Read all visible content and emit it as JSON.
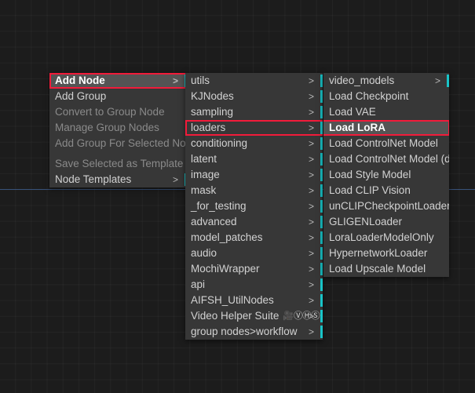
{
  "canvas": {
    "background_color": "#1c1c1c",
    "grid_color": "#2a2a2a",
    "guide_line_color": "#3d5a8a"
  },
  "theme": {
    "menu_background": "#373737",
    "text_color": "#d2d2d2",
    "disabled_text_color": "#8a8a8a",
    "hover_background": "#545454",
    "annotation_color": "#f21b3a",
    "submenu_tick_color": "#19c4c8"
  },
  "menus": {
    "root": {
      "items": [
        {
          "label": "Add Node",
          "submenu": true,
          "disabled": false,
          "highlighted": true,
          "annotated": true
        },
        {
          "label": "Add Group",
          "submenu": false,
          "disabled": false,
          "highlighted": false,
          "annotated": false
        },
        {
          "label": "Convert to Group Node",
          "submenu": false,
          "disabled": true,
          "highlighted": false,
          "annotated": false
        },
        {
          "label": "Manage Group Nodes",
          "submenu": false,
          "disabled": true,
          "highlighted": false,
          "annotated": false
        },
        {
          "label": "Add Group For Selected Nodes",
          "submenu": false,
          "disabled": true,
          "highlighted": false,
          "annotated": false
        },
        {
          "label": "Save Selected as Template",
          "submenu": false,
          "disabled": true,
          "highlighted": false,
          "annotated": false,
          "separator_above": true
        },
        {
          "label": "Node Templates",
          "submenu": true,
          "disabled": false,
          "highlighted": false,
          "annotated": false
        }
      ]
    },
    "categories": {
      "items": [
        {
          "label": "utils",
          "submenu": true,
          "annotated": false
        },
        {
          "label": "KJNodes",
          "submenu": true,
          "annotated": false
        },
        {
          "label": "sampling",
          "submenu": true,
          "annotated": false
        },
        {
          "label": "loaders",
          "submenu": true,
          "annotated": true
        },
        {
          "label": "conditioning",
          "submenu": true,
          "annotated": false
        },
        {
          "label": "latent",
          "submenu": true,
          "annotated": false
        },
        {
          "label": "image",
          "submenu": true,
          "annotated": false
        },
        {
          "label": "mask",
          "submenu": true,
          "annotated": false
        },
        {
          "label": "_for_testing",
          "submenu": true,
          "annotated": false
        },
        {
          "label": "advanced",
          "submenu": true,
          "annotated": false
        },
        {
          "label": "model_patches",
          "submenu": true,
          "annotated": false
        },
        {
          "label": "audio",
          "submenu": true,
          "annotated": false
        },
        {
          "label": "MochiWrapper",
          "submenu": true,
          "annotated": false
        },
        {
          "label": "api",
          "submenu": true,
          "annotated": false
        },
        {
          "label": "AIFSH_UtilNodes",
          "submenu": true,
          "annotated": false
        },
        {
          "label": "Video Helper Suite",
          "submenu": true,
          "annotated": false,
          "icons": "🎥ⓋⒽⓈ"
        },
        {
          "label": "group nodes>workflow",
          "submenu": true,
          "annotated": false
        }
      ]
    },
    "loaders": {
      "items": [
        {
          "label": "video_models",
          "submenu": true,
          "highlighted": false,
          "annotated": false
        },
        {
          "label": "Load Checkpoint",
          "submenu": false,
          "highlighted": false,
          "annotated": false
        },
        {
          "label": "Load VAE",
          "submenu": false,
          "highlighted": false,
          "annotated": false
        },
        {
          "label": "Load LoRA",
          "submenu": false,
          "highlighted": true,
          "annotated": true
        },
        {
          "label": "Load ControlNet Model",
          "submenu": false,
          "highlighted": false,
          "annotated": false
        },
        {
          "label": "Load ControlNet Model (diff)",
          "submenu": false,
          "highlighted": false,
          "annotated": false
        },
        {
          "label": "Load Style Model",
          "submenu": false,
          "highlighted": false,
          "annotated": false
        },
        {
          "label": "Load CLIP Vision",
          "submenu": false,
          "highlighted": false,
          "annotated": false
        },
        {
          "label": "unCLIPCheckpointLoader",
          "submenu": false,
          "highlighted": false,
          "annotated": false
        },
        {
          "label": "GLIGENLoader",
          "submenu": false,
          "highlighted": false,
          "annotated": false
        },
        {
          "label": "LoraLoaderModelOnly",
          "submenu": false,
          "highlighted": false,
          "annotated": false
        },
        {
          "label": "HypernetworkLoader",
          "submenu": false,
          "highlighted": false,
          "annotated": false
        },
        {
          "label": "Load Upscale Model",
          "submenu": false,
          "highlighted": false,
          "annotated": false
        }
      ]
    }
  },
  "icons": {
    "submenu_arrow": ">",
    "vhs_camera": "🎥",
    "vhs_v": "Ⓥ",
    "vhs_h": "Ⓗ",
    "vhs_s": "Ⓢ"
  }
}
